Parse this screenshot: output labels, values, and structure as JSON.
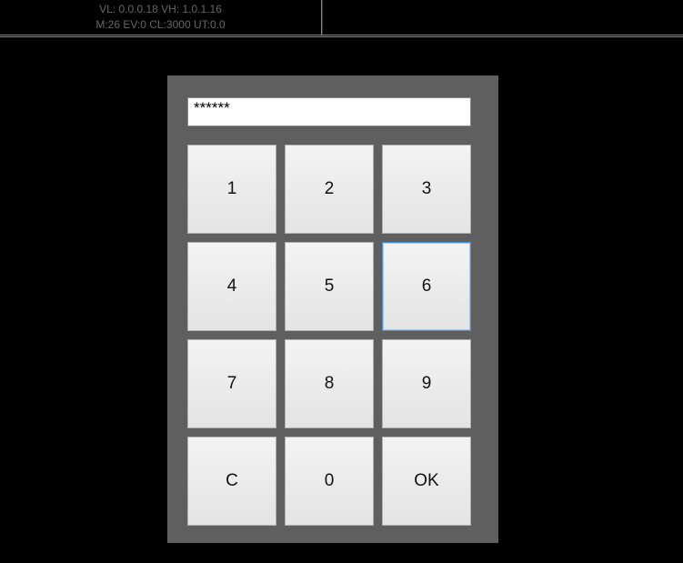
{
  "status": {
    "line1": "VL: 0.0.0.18 VH: 1.0.1.16",
    "line2": "M:26 EV:0 CL:3000 UT:0.0"
  },
  "pin": {
    "masked_value": "******"
  },
  "keypad": {
    "keys": [
      "1",
      "2",
      "3",
      "4",
      "5",
      "6",
      "7",
      "8",
      "9",
      "C",
      "0",
      "OK"
    ],
    "selected_index": 5
  }
}
